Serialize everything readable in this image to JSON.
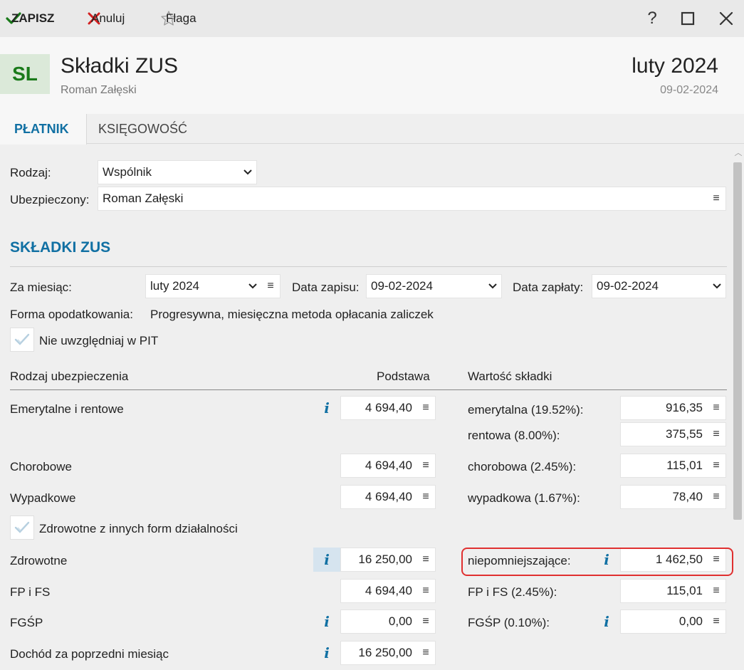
{
  "toolbar": {
    "save_label": "ZAPISZ",
    "cancel_label": "Anuluj",
    "flag_label": "Flaga",
    "help_label": "?"
  },
  "header": {
    "avatar_initials": "SL",
    "title": "Składki ZUS",
    "subtitle": "Roman Załęski",
    "period": "luty 2024",
    "date": "09-02-2024"
  },
  "tabs": [
    {
      "label": "PŁATNIK",
      "active": true
    },
    {
      "label": "KSIĘGOWOŚĆ",
      "active": false
    }
  ],
  "form": {
    "rodzaj_label": "Rodzaj:",
    "rodzaj_value": "Wspólnik",
    "ubezpieczony_label": "Ubezpieczony:",
    "ubezpieczony_value": "Roman Załęski"
  },
  "section": {
    "title": "SKŁADKI ZUS",
    "za_miesiac_label": "Za miesiąc:",
    "za_miesiac_value": "luty 2024",
    "data_zapisu_label": "Data zapisu:",
    "data_zapisu_value": "09-02-2024",
    "data_zaplaty_label": "Data zapłaty:",
    "data_zaplaty_value": "09-02-2024",
    "forma_label": "Forma opodatkowania:",
    "forma_value": "Progresywna, miesięczna metoda opłacania zaliczek",
    "nie_uwzgledniaj_label": "Nie uwzględniaj w PIT",
    "zdrowotne_inne_label": "Zdrowotne z innych form działalności"
  },
  "table": {
    "headers": {
      "rodzaj": "Rodzaj ubezpieczenia",
      "podstawa": "Podstawa",
      "wartosc": "Wartość składki"
    },
    "rows": {
      "emerytalne": {
        "label": "Emerytalne i rentowe",
        "podstawa": "4 694,40",
        "sk1_label": "emerytalna (19.52%):",
        "sk1_value": "916,35",
        "sk2_label": "rentowa (8.00%):",
        "sk2_value": "375,55"
      },
      "chorobowe": {
        "label": "Chorobowe",
        "podstawa": "4 694,40",
        "sk_label": "chorobowa (2.45%):",
        "sk_value": "115,01"
      },
      "wypadkowe": {
        "label": "Wypadkowe",
        "podstawa": "4 694,40",
        "sk_label": "wypadkowa (1.67%):",
        "sk_value": "78,40"
      },
      "zdrowotne": {
        "label": "Zdrowotne",
        "podstawa": "16 250,00",
        "sk_label": "niepomniejszające:",
        "sk_value": "1 462,50"
      },
      "fpfs": {
        "label": "FP i FS",
        "podstawa": "4 694,40",
        "sk_label": "FP i FS (2.45%):",
        "sk_value": "115,01"
      },
      "fgsp": {
        "label": "FGŚP",
        "podstawa": "0,00",
        "sk_label": "FGŚP (0.10%):",
        "sk_value": "0,00"
      },
      "dochod": {
        "label": "Dochód za poprzedni miesiąc",
        "podstawa": "16 250,00"
      }
    }
  },
  "icons": {
    "menu": "≡",
    "info": "i"
  },
  "colors": {
    "accent": "#1170a3",
    "save_green": "#1a7a1a",
    "cancel_red": "#d42020",
    "highlight_red": "#e03030"
  }
}
